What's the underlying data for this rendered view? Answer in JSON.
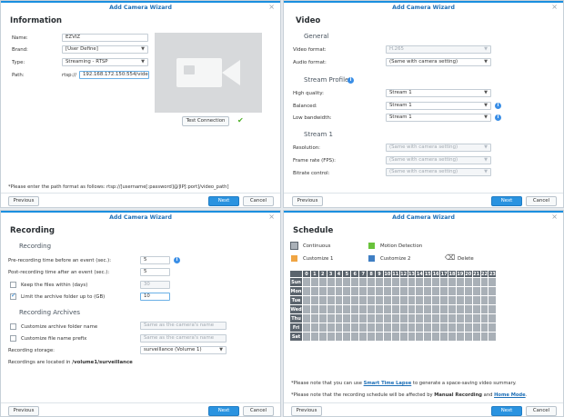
{
  "dialog_title": "Add Camera Wizard",
  "close_glyph": "×",
  "info_glyph": "i",
  "check_glyph": "✔",
  "buttons": {
    "previous": "Previous",
    "next": "Next",
    "cancel": "Cancel"
  },
  "information": {
    "heading": "Information",
    "name_label": "Name:",
    "name_value": "EZVIZ",
    "brand_label": "Brand:",
    "brand_value": "[User Define]",
    "type_label": "Type:",
    "type_value": "Streaming - RTSP",
    "path_label": "Path:",
    "path_prefix": "rtsp://",
    "path_value": "192.168.172.150:554/video",
    "test_button": "Test Connection",
    "hint": "*Please enter the path format as follows: rtsp://[username[:password]@]IP[:port]/video_path]"
  },
  "video": {
    "heading": "Video",
    "general": "General",
    "video_format_label": "Video format:",
    "video_format_value": "H.265",
    "audio_format_label": "Audio format:",
    "audio_format_value": "(Same with camera setting)",
    "stream_profile": "Stream Profile",
    "high_label": "High quality:",
    "high_value": "Stream 1",
    "balanced_label": "Balanced:",
    "balanced_value": "Stream 1",
    "low_label": "Low bandwidth:",
    "low_value": "Stream 1",
    "stream1": "Stream 1",
    "resolution_label": "Resolution:",
    "resolution_value": "(Same with camera setting)",
    "fps_label": "Frame rate (FPS):",
    "fps_value": "(Same with camera setting)",
    "bitrate_label": "Bitrate control:",
    "bitrate_value": "(Same with camera setting)"
  },
  "recording": {
    "heading": "Recording",
    "section": "Recording",
    "pre_label": "Pre-recording time before an event (sec.):",
    "pre_value": "5",
    "post_label": "Post-recording time after an event (sec.):",
    "post_value": "5",
    "keep_label": "Keep the files within (days)",
    "keep_value": "30",
    "limit_label": "Limit the archive folder up to (GB)",
    "limit_value": "10",
    "archives": "Recording Archives",
    "custom_folder_label": "Customize archive folder name",
    "custom_folder_placeholder": "Same as the camera's name",
    "custom_prefix_label": "Customize file name prefix",
    "custom_prefix_placeholder": "Same as the camera's name",
    "storage_label": "Recording storage:",
    "storage_value": "surveillance (Volume 1)",
    "location_text": "Recordings are located in",
    "location_path": "/volume1/surveillance"
  },
  "schedule": {
    "heading": "Schedule",
    "legend": [
      {
        "label": "Continuous",
        "color": "#a9b0b7"
      },
      {
        "label": "Motion Detection",
        "color": "#69c23b"
      },
      {
        "label": "Delete",
        "color": "#ffffff"
      },
      {
        "label": "Customize 1",
        "color": "#f0a543"
      },
      {
        "label": "Customize 2",
        "color": "#3f7fc4"
      }
    ],
    "hours": [
      "0",
      "1",
      "2",
      "3",
      "4",
      "5",
      "6",
      "7",
      "8",
      "9",
      "10",
      "11",
      "12",
      "13",
      "14",
      "15",
      "16",
      "17",
      "18",
      "19",
      "20",
      "21",
      "22",
      "23"
    ],
    "days": [
      "Sun",
      "Mon",
      "Tue",
      "Wed",
      "Thu",
      "Fri",
      "Sat"
    ],
    "note1_pre": "*Please note that you can use",
    "note1_link": "Smart Time Lapse",
    "note1_post": "to generate a space-saving video summary.",
    "note2_pre": "*Please note that the recording schedule will be affected by",
    "note2_link1": "Manual Recording",
    "note2_mid": "and",
    "note2_link2": "Home Mode",
    "note2_end": "."
  }
}
